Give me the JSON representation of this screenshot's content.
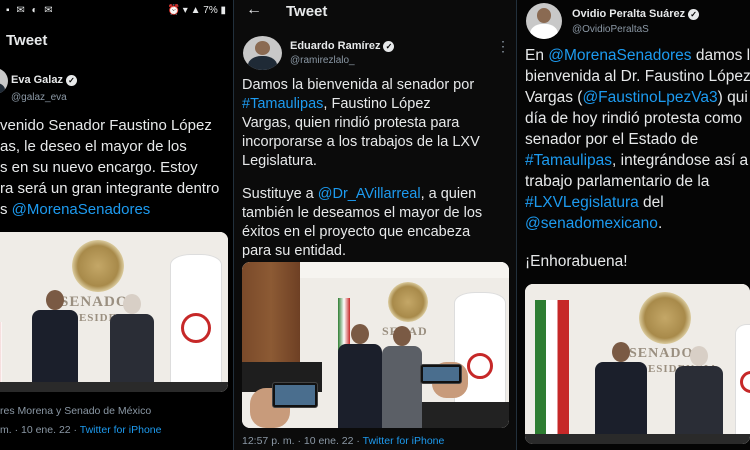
{
  "panel1": {
    "status_left": "▪ ✉ ◐ ✉",
    "status_right": "7%",
    "title": "Tweet",
    "author": "Eva Galaz",
    "handle": "@galaz_eva",
    "lines": [
      "venido Senador Faustino López",
      "as, le deseo el mayor de los",
      "s en su nuevo encargo. Estoy",
      "ra será un gran integrante dentro",
      "s "
    ],
    "mention_line5": "@MorenaSenadores",
    "photo_letters_1": "SENADO",
    "photo_letters_2": "RESIDENCIA",
    "caption": "res Morena y Senado de México",
    "timestamp": "m. · 10 ene. 22 · ",
    "source": "Twitter for iPhone"
  },
  "panel2": {
    "title": "Tweet",
    "author": "Eduardo Ramírez",
    "handle": "@ramirezlalo_",
    "line1": "Damos la bienvenida al senador por",
    "line2_mention": "#Tamaulipas",
    "line2_rest": ", Faustino López",
    "line3": "Vargas, quien rindió protesta para",
    "line4": "incorporarse a los trabajos de la LXV",
    "line5": "Legislatura.",
    "line6_pre": "Sustituye a ",
    "line6_mention": "@Dr_AVillarreal",
    "line6_post": ", a quien",
    "line7": "también le deseamos el mayor de los",
    "line8": "éxitos en el proyecto que encabeza",
    "line9": "para su entidad.",
    "photo_letters": "SENAD",
    "timestamp": "12:57 p. m. · 10 ene. 22 · ",
    "source": "Twitter for iPhone"
  },
  "panel3": {
    "author": "Ovidio Peralta Suárez",
    "handle": "@OvidioPeraltaS",
    "l1_pre": "En ",
    "l1_mention": "@MorenaSenadores",
    "l1_post": " damos l",
    "l2": "bienvenida al Dr. Faustino López",
    "l3_pre": "Vargas (",
    "l3_mention": "@FaustinoLpezVa3",
    "l3_post": ") qui",
    "l4": "día de hoy rindió protesta como",
    "l5": "senador por el Estado de",
    "l6_mention": "#Tamaulipas",
    "l6_post": ", integrándose así a",
    "l7": "trabajo parlamentario de la",
    "l8_mention": "#LXVLegislatura",
    "l8_post": " del",
    "l9_mention": "@senadomexicano",
    "l9_post": ".",
    "l10": "¡Enhorabuena!",
    "photo_letters_1": "SENADO",
    "photo_letters_2": "RESIDENCIA"
  },
  "colors": {
    "link": "#1d9bf0",
    "text": "#e7e9ea",
    "muted": "#8b98a5",
    "background": "#000000"
  },
  "icons": [
    "verified-badge-icon",
    "back-arrow-icon",
    "more-options-icon",
    "battery-icon",
    "wifi-icon"
  ]
}
